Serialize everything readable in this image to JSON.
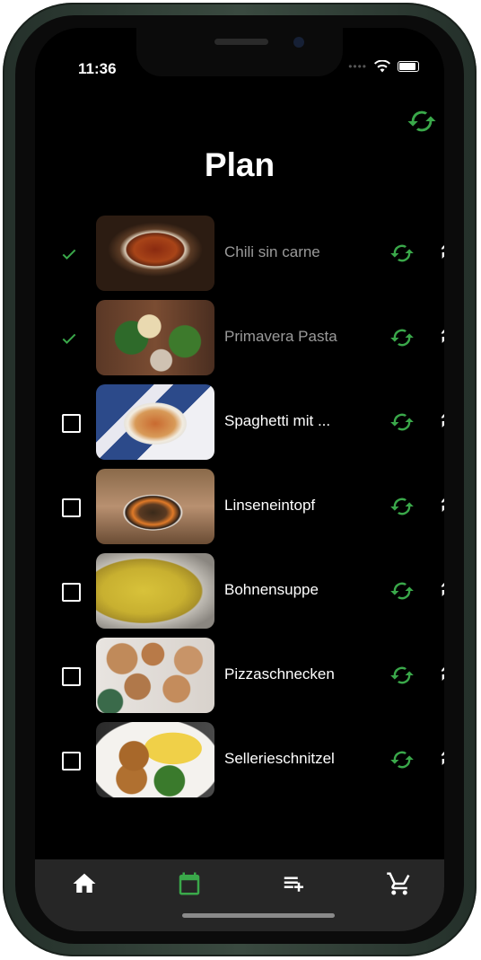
{
  "status_bar": {
    "time": "11:36"
  },
  "header": {
    "title": "Plan"
  },
  "colors": {
    "accent": "#3aa84a",
    "background": "#000000",
    "tabbar": "#262626"
  },
  "meals": [
    {
      "name": "Chili sin carne",
      "checked": true,
      "image": "chili-bowl"
    },
    {
      "name": "Primavera Pasta",
      "checked": true,
      "image": "pasta-spinach"
    },
    {
      "name": "Spaghetti mit ...",
      "checked": false,
      "image": "spaghetti-meatballs"
    },
    {
      "name": "Linseneintopf",
      "checked": false,
      "image": "lentil-stew"
    },
    {
      "name": "Bohnensuppe",
      "checked": false,
      "image": "bean-soup"
    },
    {
      "name": "Pizzaschnecken",
      "checked": false,
      "image": "pizza-rolls"
    },
    {
      "name": "Sellerieschnitzel",
      "checked": false,
      "image": "celery-schnitzel"
    }
  ],
  "tabs": [
    {
      "icon": "home-icon",
      "active": false
    },
    {
      "icon": "calendar-icon",
      "active": true
    },
    {
      "icon": "playlist-add-icon",
      "active": false
    },
    {
      "icon": "cart-icon",
      "active": false
    }
  ]
}
